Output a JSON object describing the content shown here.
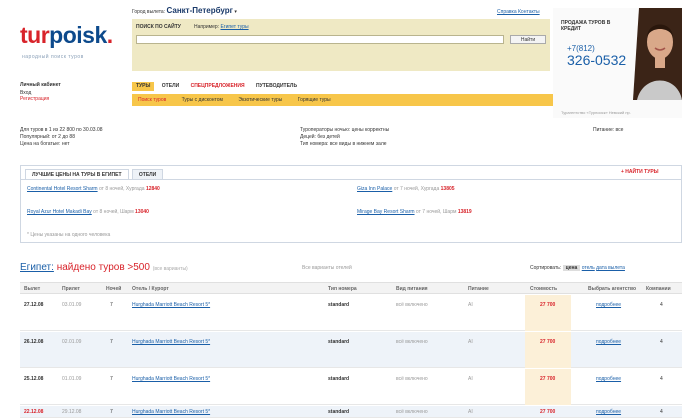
{
  "logo": {
    "tur": "tur",
    "poisk": "poisk",
    "dot": ".",
    "tagline": "народный поиск туров"
  },
  "header": {
    "city_label": "Город вылета:",
    "city": "Санкт-Петербург",
    "top_links": "Справка   Контакты",
    "search_label": "ПОИСК ПО САЙТУ",
    "search_example_prefix": "Например:",
    "search_example": "Египет туры",
    "search_placeholder": "",
    "search_button": "Найти"
  },
  "promo": {
    "title": "ПРОДАЖА ТУРОВ В КРЕДИТ",
    "code": "+7(812)",
    "phone": "326-0532",
    "note": "Турагентство «Турпоиск» Невский пр."
  },
  "left_block": {
    "title": "Личный кабинет",
    "items": [
      "Вход",
      "Регистрация"
    ]
  },
  "nav": {
    "tabs": [
      "ТУРЫ",
      "ОТЕЛИ",
      "СПЕЦПРЕДЛОЖЕНИЯ",
      "ПУТЕВОДИТЕЛЬ"
    ],
    "subnav": [
      "Поиск туров",
      "Туры с дисконтом",
      "Экзотические туры",
      "Горящие туры"
    ]
  },
  "info": {
    "left": [
      "Для туров в 1 из 22 800 по 30.03.08",
      "Популярный: от 2 до 88",
      "Цена на богатые: нет"
    ],
    "mid": [
      "Туроператоры ночью: цены корректны",
      "Децей: без детей",
      "Тип номера: все виды в нижнем зале"
    ],
    "right": "Питание: все"
  },
  "best": {
    "tabs": [
      "ЛУЧШИЕ ЦЕНЫ НА ТУРЫ В ЕГИПЕТ",
      "ОТЕЛИ"
    ],
    "select_button": "+ НАЙТИ ТУРЫ",
    "offers": [
      {
        "name": "Continental Hotel Resort Sharm",
        "desc": "от 8 ночей, Хургада",
        "price": "12840"
      },
      {
        "name": "Giza Inn Palace",
        "desc": "от 7 ночей, Хургада",
        "price": "13805"
      },
      {
        "name": "Royal Azur Hotel Makadi Bay",
        "desc": "от 8 ночей, Шарм",
        "price": "13040"
      },
      {
        "name": "Mirage Bay Resort Sharm",
        "desc": "от 7 ночей, Шарм",
        "price": "13819"
      }
    ],
    "note": "* Цены указаны на одного человека"
  },
  "results": {
    "title_prefix": "Египет:",
    "title_main": "найдено туров >500",
    "title_small": "(все варианты)",
    "sub": "Все варианты отелей",
    "sort_label": "Сортировать:",
    "sort_options": [
      "цена",
      "отель",
      "дата вылета"
    ],
    "columns": [
      "Вылет",
      "Прилет",
      "Ночей",
      "Отель / Курорт",
      "Тип номера",
      "Вид питания",
      "Питание",
      "Стоимость",
      "Выбрать агентство",
      "Компании"
    ],
    "rows": [
      {
        "date": "27.12.08",
        "ret": "03.01.09",
        "nights": "7",
        "hotel": "Hurghada Marriott Beach Resort 5*",
        "room": "standard",
        "meal": "всё включено",
        "food": "AI",
        "price": "27 700",
        "agency": "подробнее",
        "co": "4"
      },
      {
        "date": "26.12.08",
        "ret": "02.01.09",
        "nights": "7",
        "hotel": "Hurghada Marriott Beach Resort 5*",
        "room": "standard",
        "meal": "всё включено",
        "food": "AI",
        "price": "27 700",
        "agency": "подробнее",
        "co": "4"
      },
      {
        "date": "25.12.08",
        "ret": "01.01.09",
        "nights": "7",
        "hotel": "Hurghada Marriott Beach Resort 5*",
        "room": "standard",
        "meal": "всё включено",
        "food": "AI",
        "price": "27 700",
        "agency": "подробнее",
        "co": "4"
      },
      {
        "date": "22.12.08",
        "ret": "29.12.08",
        "nights": "7",
        "hotel": "Hurghada Marriott Beach Resort 5*",
        "room": "standard",
        "meal": "всё включено",
        "food": "AI",
        "price": "27 700",
        "agency": "подробнее",
        "co": "4"
      }
    ]
  },
  "colors": {
    "brand_red": "#d8232a",
    "brand_blue": "#0d4a8c",
    "accent_yellow": "#f7c64a"
  }
}
